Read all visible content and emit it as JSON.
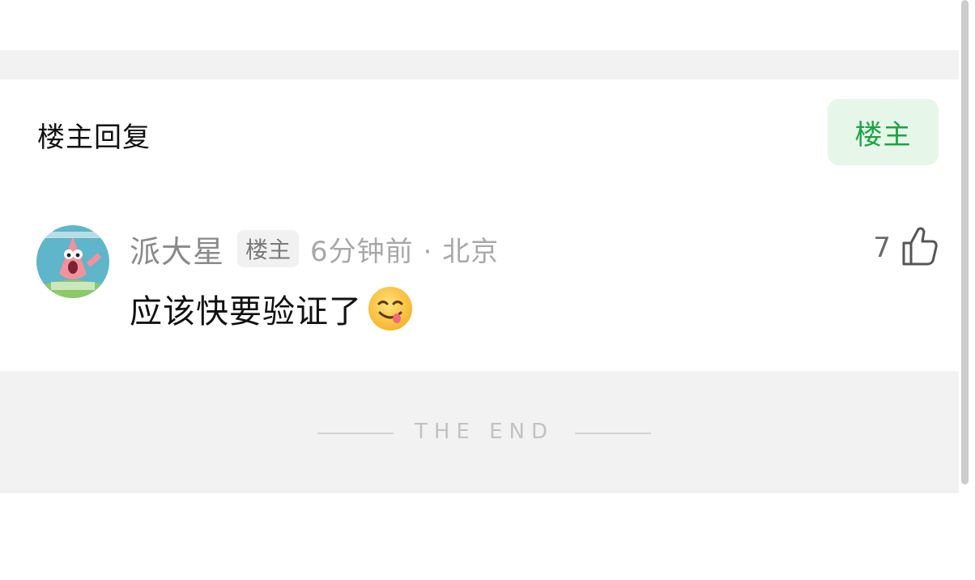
{
  "section": {
    "title": "楼主回复",
    "filter_label": "楼主"
  },
  "comment": {
    "username": "派大星",
    "badge": "楼主",
    "time_location": "6分钟前 · 北京",
    "text": "应该快要验证了",
    "emoji": "yum-face-emoji",
    "like_count": "7",
    "like_icon": "thumbs-up-icon"
  },
  "footer": {
    "end_text": "THE END"
  },
  "colors": {
    "accent_green": "#1fa244",
    "badge_green_bg": "#e6f7ea",
    "band_gray": "#f2f2f2"
  }
}
